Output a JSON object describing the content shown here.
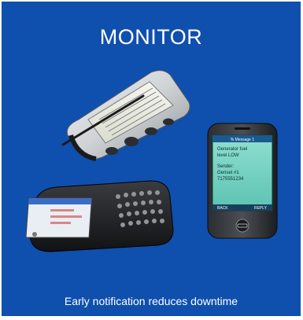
{
  "title": "MONITOR",
  "caption": "Early notification reduces downtime",
  "phone_screen": {
    "header": "% Message 1",
    "line1": "Generator fuel",
    "line2": "level LOW",
    "line3": "Sender:",
    "line4": "Genset #1",
    "line5": "7175551234",
    "btn_back": "BACK",
    "btn_reply": "REPLY"
  },
  "colors": {
    "panel": "#0f4fae",
    "text": "#ffffff"
  }
}
